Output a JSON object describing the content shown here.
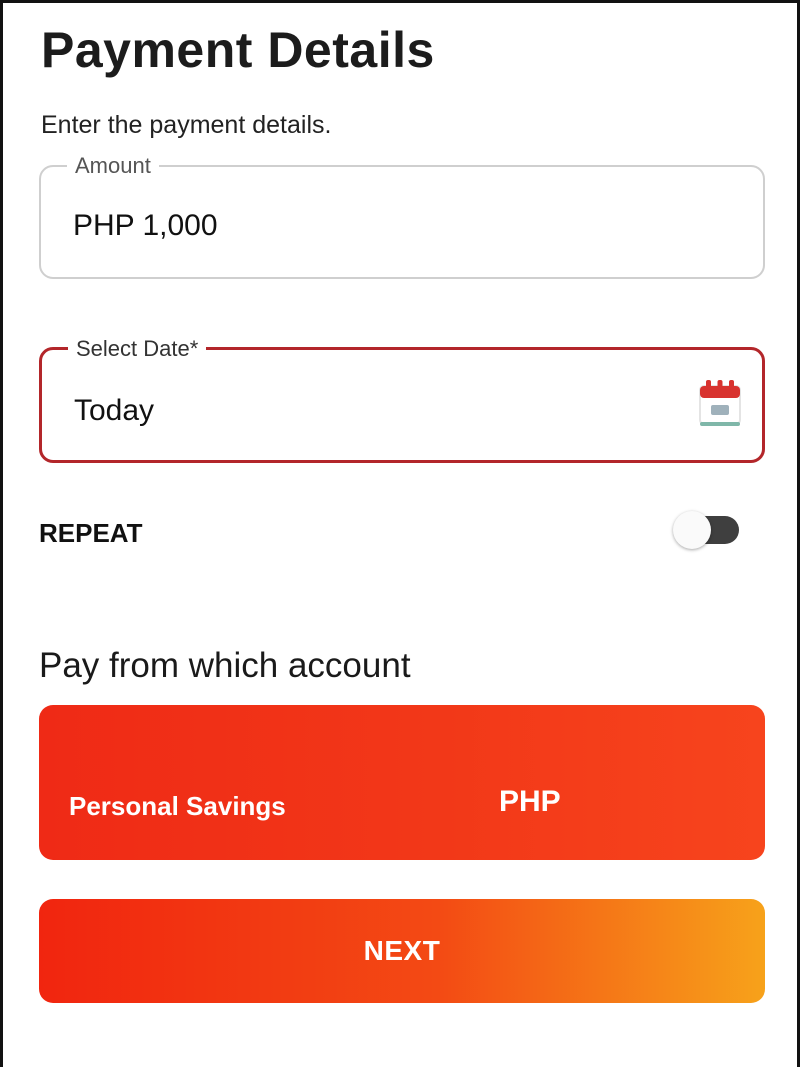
{
  "header": {
    "title": "Payment Details",
    "subtitle": "Enter the payment details."
  },
  "amount_field": {
    "label": "Amount",
    "value": "PHP  1,000"
  },
  "date_field": {
    "label": "Select Date*",
    "value": "Today",
    "icon": "calendar-icon",
    "accent_color": "#b3262a"
  },
  "repeat": {
    "label": "REPEAT",
    "enabled": false
  },
  "account_section": {
    "heading": "Pay from which account",
    "selected_account": {
      "name": "Personal Savings",
      "currency": "PHP"
    }
  },
  "footer": {
    "next_label": "NEXT"
  },
  "colors": {
    "brand_red": "#f02a14",
    "brand_orange": "#f7a21a"
  }
}
